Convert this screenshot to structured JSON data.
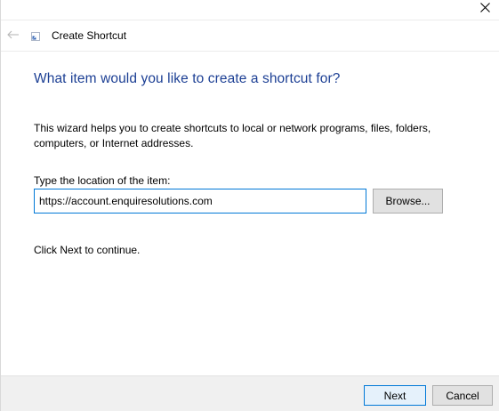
{
  "window": {
    "title": "Create Shortcut",
    "close_icon": "close-icon",
    "back_icon": "back-arrow-icon",
    "app_icon": "shortcut-icon"
  },
  "main": {
    "heading": "What item would you like to create a shortcut for?",
    "description": "This wizard helps you to create shortcuts to local or network programs, files, folders, computers, or Internet addresses.",
    "location_label": "Type the location of the item:",
    "location_value": "https://account.enquiresolutions.com",
    "browse_label": "Browse...",
    "continue_text": "Click Next to continue."
  },
  "footer": {
    "next_label": "Next",
    "cancel_label": "Cancel"
  },
  "colors": {
    "heading": "#1c3f94",
    "focus_border": "#0078d7",
    "footer_bg": "#f0f0f0",
    "button_bg": "#e1e1e1"
  }
}
